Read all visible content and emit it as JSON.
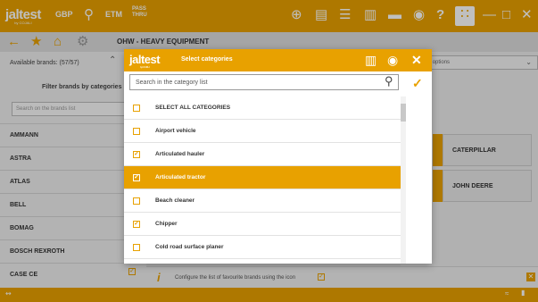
{
  "app": {
    "logo": "jaltest",
    "logo_sub": "by COJALI",
    "toolbar": [
      "GBP",
      "ETM",
      "PASS THRU"
    ]
  },
  "navbar": {
    "breadcrumb": "OHW - HEAVY EQUIPMENT"
  },
  "left_panel": {
    "available_label": "Available brands: (57/57)",
    "filter_label": "Filter brands by categories",
    "search_placeholder": "Search on the brands list",
    "brands": [
      "AMMANN",
      "ASTRA",
      "ATLAS",
      "BELL",
      "BOMAG",
      "BOSCH REXROTH",
      "CASE CE"
    ]
  },
  "right_panel": {
    "connection_label": "connection options",
    "tiles": [
      "CATERPILLAR",
      "JOHN DEERE"
    ]
  },
  "bottom_bar": {
    "hint": "Configure the list of favourite brands using the icon"
  },
  "modal": {
    "logo": "jaltest",
    "logo_sub": "by COJALI",
    "title": "Select categories",
    "search_placeholder": "Search in the category list",
    "items": [
      {
        "label": "SELECT ALL CATEGORIES",
        "checked": false
      },
      {
        "label": "Airport vehicle",
        "checked": false
      },
      {
        "label": "Articulated hauler",
        "checked": true
      },
      {
        "label": "Articulated tractor",
        "checked": true
      },
      {
        "label": "Beach cleaner",
        "checked": false
      },
      {
        "label": "Chipper",
        "checked": true
      },
      {
        "label": "Cold road surface planer",
        "checked": false
      }
    ]
  },
  "colors": {
    "accent": "#e8a100",
    "panel": "#efefef"
  }
}
